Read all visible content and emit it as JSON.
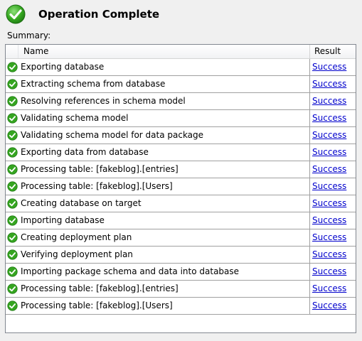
{
  "header": {
    "title": "Operation Complete",
    "icon": "green-check-circle-icon"
  },
  "summary_label": "Summary:",
  "columns": {
    "name": "Name",
    "result": "Result"
  },
  "colors": {
    "success_green": "#2e9d1b",
    "link_blue": "#0000cc",
    "grid_border": "#828790"
  },
  "rows": [
    {
      "name": "Exporting database",
      "result": "Success"
    },
    {
      "name": "Extracting schema from database",
      "result": "Success"
    },
    {
      "name": "Resolving references in schema model",
      "result": "Success"
    },
    {
      "name": "Validating schema model",
      "result": "Success"
    },
    {
      "name": "Validating schema model for data package",
      "result": "Success"
    },
    {
      "name": "Exporting data from database",
      "result": "Success"
    },
    {
      "name": "Processing table: [fakeblog].[entries]",
      "result": "Success"
    },
    {
      "name": "Processing table: [fakeblog].[Users]",
      "result": "Success"
    },
    {
      "name": "Creating database on target",
      "result": "Success"
    },
    {
      "name": "Importing database",
      "result": "Success"
    },
    {
      "name": "Creating deployment plan",
      "result": "Success"
    },
    {
      "name": "Verifying deployment plan",
      "result": "Success"
    },
    {
      "name": "Importing package schema and data into database",
      "result": "Success"
    },
    {
      "name": "Processing table: [fakeblog].[entries]",
      "result": "Success"
    },
    {
      "name": "Processing table: [fakeblog].[Users]",
      "result": "Success"
    }
  ]
}
